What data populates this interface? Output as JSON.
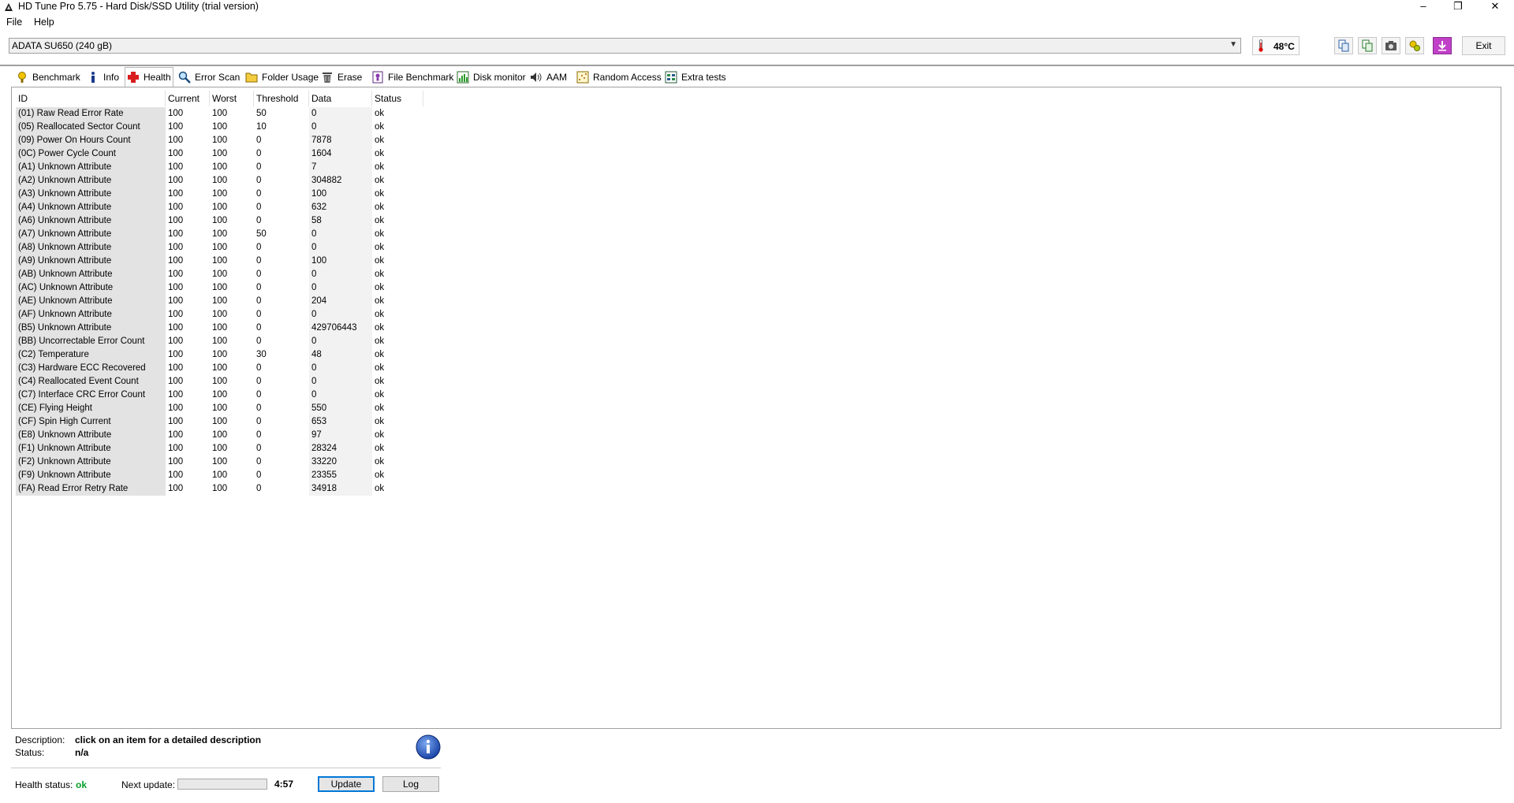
{
  "window": {
    "title": "HD Tune Pro 5.75 - Hard Disk/SSD Utility (trial version)",
    "minimize": "–",
    "maximize": "❐",
    "close": "✕"
  },
  "menu": {
    "file": "File",
    "help": "Help"
  },
  "drive": {
    "selected": "ADATA SU650 (240 gB)",
    "temperature": "48°C",
    "exit_label": "Exit"
  },
  "toolbar_icons": [
    "copy-text-icon",
    "copy-info-icon",
    "screenshot-camera-icon",
    "options-icon",
    "save-download-icon"
  ],
  "tabs": [
    {
      "label": "Benchmark",
      "icon": "benchmark-icon",
      "active": false
    },
    {
      "label": "Info",
      "icon": "info-icon",
      "active": false
    },
    {
      "label": "Health",
      "icon": "health-cross-icon",
      "active": true
    },
    {
      "label": "Error Scan",
      "icon": "error-scan-icon",
      "active": false
    },
    {
      "label": "Folder Usage",
      "icon": "folder-icon",
      "active": false
    },
    {
      "label": "Erase",
      "icon": "erase-bin-icon",
      "active": false
    },
    {
      "label": "File Benchmark",
      "icon": "file-benchmark-icon",
      "active": false
    },
    {
      "label": "Disk monitor",
      "icon": "disk-monitor-icon",
      "active": false
    },
    {
      "label": "AAM",
      "icon": "speaker-icon",
      "active": false
    },
    {
      "label": "Random Access",
      "icon": "random-access-icon",
      "active": false
    },
    {
      "label": "Extra tests",
      "icon": "extra-tests-icon",
      "active": false
    }
  ],
  "table": {
    "columns": [
      "ID",
      "Current",
      "Worst",
      "Threshold",
      "Data",
      "Status"
    ],
    "rows": [
      [
        "(01) Raw Read Error Rate",
        "100",
        "100",
        "50",
        "0",
        "ok"
      ],
      [
        "(05) Reallocated Sector Count",
        "100",
        "100",
        "10",
        "0",
        "ok"
      ],
      [
        "(09) Power On Hours Count",
        "100",
        "100",
        "0",
        "7878",
        "ok"
      ],
      [
        "(0C) Power Cycle Count",
        "100",
        "100",
        "0",
        "1604",
        "ok"
      ],
      [
        "(A1) Unknown Attribute",
        "100",
        "100",
        "0",
        "7",
        "ok"
      ],
      [
        "(A2) Unknown Attribute",
        "100",
        "100",
        "0",
        "304882",
        "ok"
      ],
      [
        "(A3) Unknown Attribute",
        "100",
        "100",
        "0",
        "100",
        "ok"
      ],
      [
        "(A4) Unknown Attribute",
        "100",
        "100",
        "0",
        "632",
        "ok"
      ],
      [
        "(A6) Unknown Attribute",
        "100",
        "100",
        "0",
        "58",
        "ok"
      ],
      [
        "(A7) Unknown Attribute",
        "100",
        "100",
        "50",
        "0",
        "ok"
      ],
      [
        "(A8) Unknown Attribute",
        "100",
        "100",
        "0",
        "0",
        "ok"
      ],
      [
        "(A9) Unknown Attribute",
        "100",
        "100",
        "0",
        "100",
        "ok"
      ],
      [
        "(AB) Unknown Attribute",
        "100",
        "100",
        "0",
        "0",
        "ok"
      ],
      [
        "(AC) Unknown Attribute",
        "100",
        "100",
        "0",
        "0",
        "ok"
      ],
      [
        "(AE) Unknown Attribute",
        "100",
        "100",
        "0",
        "204",
        "ok"
      ],
      [
        "(AF) Unknown Attribute",
        "100",
        "100",
        "0",
        "0",
        "ok"
      ],
      [
        "(B5) Unknown Attribute",
        "100",
        "100",
        "0",
        "429706443",
        "ok"
      ],
      [
        "(BB) Uncorrectable Error Count",
        "100",
        "100",
        "0",
        "0",
        "ok"
      ],
      [
        "(C2) Temperature",
        "100",
        "100",
        "30",
        "48",
        "ok"
      ],
      [
        "(C3) Hardware ECC Recovered",
        "100",
        "100",
        "0",
        "0",
        "ok"
      ],
      [
        "(C4) Reallocated Event Count",
        "100",
        "100",
        "0",
        "0",
        "ok"
      ],
      [
        "(C7) Interface CRC Error Count",
        "100",
        "100",
        "0",
        "0",
        "ok"
      ],
      [
        "(CE) Flying Height",
        "100",
        "100",
        "0",
        "550",
        "ok"
      ],
      [
        "(CF) Spin High Current",
        "100",
        "100",
        "0",
        "653",
        "ok"
      ],
      [
        "(E8) Unknown Attribute",
        "100",
        "100",
        "0",
        "97",
        "ok"
      ],
      [
        "(F1) Unknown Attribute",
        "100",
        "100",
        "0",
        "28324",
        "ok"
      ],
      [
        "(F2) Unknown Attribute",
        "100",
        "100",
        "0",
        "33220",
        "ok"
      ],
      [
        "(F9) Unknown Attribute",
        "100",
        "100",
        "0",
        "23355",
        "ok"
      ],
      [
        "(FA) Read Error Retry Rate",
        "100",
        "100",
        "0",
        "34918",
        "ok"
      ]
    ]
  },
  "details": {
    "description_label": "Description:",
    "description_value": "click on an item for a detailed description",
    "status_label": "Status:",
    "status_value": "n/a"
  },
  "footer": {
    "health_label": "Health status:",
    "health_value": "ok",
    "next_update_label": "Next update:",
    "next_update_progress": 0.0,
    "countdown": "4:57",
    "update_label": "Update",
    "log_label": "Log"
  },
  "colors": {
    "health_ok": "#06a02a",
    "accent": "#0078d7"
  }
}
